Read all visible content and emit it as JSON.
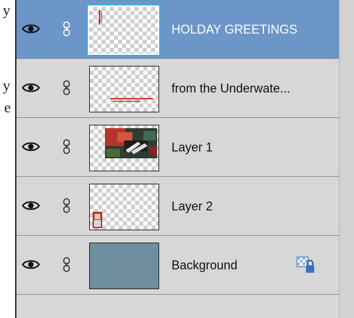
{
  "left_fragments": [
    {
      "text": "y"
    },
    {
      "text": "y"
    },
    {
      "text": "e"
    }
  ],
  "layers": [
    {
      "name": "HOLDAY GREETINGS",
      "selected": true,
      "visible": true,
      "linked": true,
      "thumbnail": "vertical-text"
    },
    {
      "name": "from the Underwate...",
      "selected": false,
      "visible": true,
      "linked": true,
      "thumbnail": "small-red-text"
    },
    {
      "name": "Layer 1",
      "selected": false,
      "visible": true,
      "linked": true,
      "thumbnail": "photo-collage"
    },
    {
      "name": "Layer 2",
      "selected": false,
      "visible": true,
      "linked": true,
      "thumbnail": "small-portrait"
    },
    {
      "name": "Background",
      "selected": false,
      "visible": true,
      "linked": true,
      "thumbnail": "solid-blue-gray",
      "locked": true
    }
  ],
  "icons": {
    "visibility": "eye-icon",
    "link": "chain-link-icon",
    "lock": "transparency-lock-icon"
  },
  "colors": {
    "selected_row": "#6c95c8",
    "panel_bg": "#d7d7d7",
    "background_fill": "#6f8f9e",
    "thumb_outline": "#3fa9e0"
  }
}
